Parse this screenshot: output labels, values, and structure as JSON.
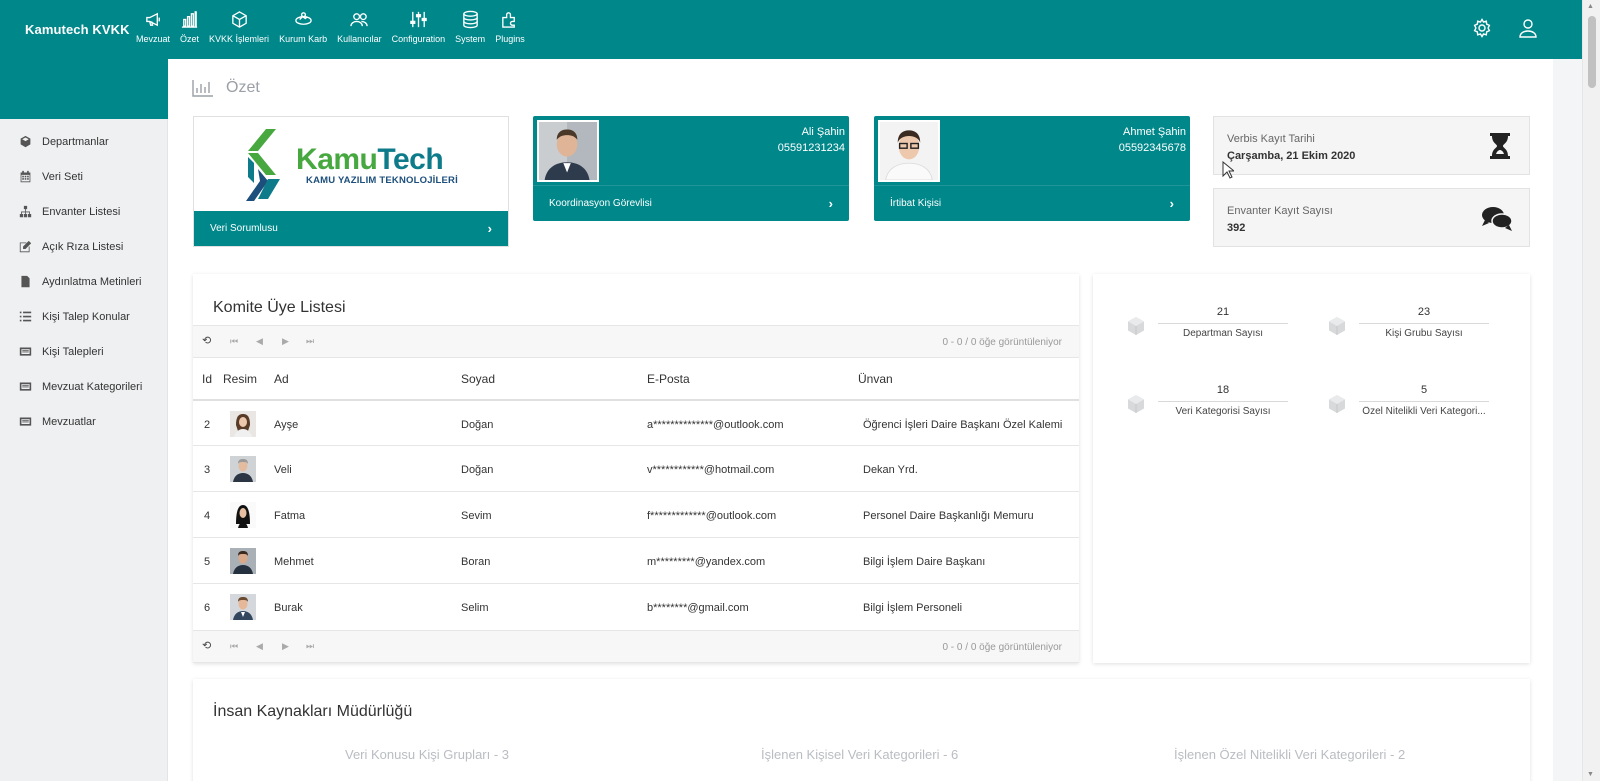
{
  "app": {
    "title": "Kamutech KVKK"
  },
  "nav": [
    {
      "label": "Mevzuat",
      "icon": "megaphone-icon"
    },
    {
      "label": "Özet",
      "icon": "bar-chart-icon"
    },
    {
      "label": "KVKK İşlemleri",
      "icon": "cube-icon"
    },
    {
      "label": "Kurum Karb",
      "icon": "handshake-icon"
    },
    {
      "label": "Kullanıcılar",
      "icon": "users-icon"
    },
    {
      "label": "Configuration",
      "icon": "sliders-icon"
    },
    {
      "label": "System",
      "icon": "database-icon"
    },
    {
      "label": "Plugins",
      "icon": "puzzle-icon"
    }
  ],
  "sidebar": {
    "items": [
      {
        "label": "Departmanlar",
        "icon": "cube-icon"
      },
      {
        "label": "Veri Seti",
        "icon": "calendar-icon"
      },
      {
        "label": "Envanter Listesi",
        "icon": "sitemap-icon"
      },
      {
        "label": "Açık Rıza Listesi",
        "icon": "edit-icon"
      },
      {
        "label": "Aydınlatma Metinleri",
        "icon": "file-icon"
      },
      {
        "label": "Kişi Talep Konular",
        "icon": "list-icon"
      },
      {
        "label": "Kişi Talepleri",
        "icon": "card-icon"
      },
      {
        "label": "Mevzuat Kategorileri",
        "icon": "card-icon"
      },
      {
        "label": "Mevzuatlar",
        "icon": "card-icon"
      }
    ]
  },
  "page": {
    "title": "Özet"
  },
  "logo_card": {
    "logo_kamu": "Kamu",
    "logo_tech": "Tech",
    "logo_sub": "KAMU YAZILIM TEKNOLOJİLERİ",
    "footer": "Veri Sorumlusu"
  },
  "coordinator": {
    "name": "Ali Şahin",
    "phone": "05591231234",
    "footer": "Koordinasyon Görevlisi"
  },
  "contact": {
    "name": "Ahmet Şahin",
    "phone": "05592345678",
    "footer": "İrtibat Kişisi"
  },
  "verbis": {
    "label": "Verbis Kayıt Tarihi",
    "value": "Çarşamba, 21 Ekim 2020"
  },
  "inventory": {
    "label": "Envanter Kayıt Sayısı",
    "value": "392"
  },
  "komite": {
    "title": "Komite Üye Listesi",
    "pager_info": "0 - 0 / 0 öğe görüntüleniyor",
    "columns": [
      "Id",
      "Resim",
      "Ad",
      "Soyad",
      "E-Posta",
      "Ünvan"
    ],
    "rows": [
      {
        "id": "2",
        "ad": "Ayşe",
        "soyad": "Doğan",
        "email": "a**************@outlook.com",
        "unvan": "Öğrenci İşleri Daire Başkanı Özel Kalemi"
      },
      {
        "id": "3",
        "ad": "Veli",
        "soyad": "Doğan",
        "email": "v************@hotmail.com",
        "unvan": "Dekan Yrd."
      },
      {
        "id": "4",
        "ad": "Fatma",
        "soyad": "Sevim",
        "email": "f*************@outlook.com",
        "unvan": "Personel Daire Başkanlığı Memuru"
      },
      {
        "id": "5",
        "ad": "Mehmet",
        "soyad": "Boran",
        "email": "m*********@yandex.com",
        "unvan": "Bilgi İşlem Daire Başkanı"
      },
      {
        "id": "6",
        "ad": "Burak",
        "soyad": "Selim",
        "email": "b********@gmail.com",
        "unvan": "Bilgi İşlem Personeli"
      }
    ]
  },
  "stats": [
    {
      "value": "21",
      "label": "Departman Sayısı"
    },
    {
      "value": "23",
      "label": "Kişi Grubu Sayısı"
    },
    {
      "value": "18",
      "label": "Veri Kategorisi Sayısı"
    },
    {
      "value": "5",
      "label": "Özel Nitelikli Veri Kategori..."
    }
  ],
  "ik": {
    "title": "İnsan Kaynakları Müdürlüğü",
    "subs": [
      "Veri Konusu Kişi Grupları - 3",
      "İşlenen Kişisel Veri Kategorileri - 6",
      "İşlenen Özel Nitelikli Veri Kategorileri - 2"
    ]
  },
  "colors": {
    "primary": "#00878a",
    "logo_green": "#46a83f",
    "logo_blue": "#0d7b8a"
  }
}
